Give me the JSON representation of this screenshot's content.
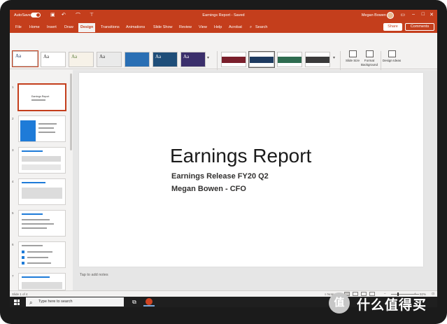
{
  "titlebar": {
    "autosave_label": "AutoSave",
    "autosave_state": "On",
    "doc_title": "Earnings Report - Saved",
    "user_name": "Megan Bowen"
  },
  "tabs": [
    "File",
    "Home",
    "Insert",
    "Draw",
    "Design",
    "Transitions",
    "Animations",
    "Slide Show",
    "Review",
    "View",
    "Help",
    "Acrobat"
  ],
  "active_tab": "Design",
  "search": {
    "label": "Search"
  },
  "share_label": "Share",
  "comments_label": "Comments",
  "ribbon": {
    "themes": [
      {
        "label": "Aa",
        "bg": "#ffffff",
        "fg": "#1f3864"
      },
      {
        "label": "Aa",
        "bg": "#ffffff",
        "fg": "#323130"
      },
      {
        "label": "Aa",
        "bg": "#f7f2e8",
        "fg": "#5a7c3a"
      },
      {
        "label": "Aa",
        "bg": "#eaeaea",
        "fg": "#323130"
      },
      {
        "label": "",
        "bg": "#2a6fb4",
        "fg": "#ffffff"
      },
      {
        "label": "Aa",
        "bg": "#1f4e79",
        "fg": "#ffffff"
      },
      {
        "label": "Aa",
        "bg": "#3b2f6b",
        "fg": "#ffffff"
      }
    ],
    "themes_group_label": "Themes",
    "variants": [
      {
        "bg": "#7a1f2b"
      },
      {
        "bg": "#1e3a5f"
      },
      {
        "bg": "#2e6b4f"
      },
      {
        "bg": "#3a3a3a"
      }
    ],
    "variants_group_label": "Variants",
    "slide_size_label": "Slide Size",
    "format_background_label": "Format Background",
    "customize_group_label": "Customize",
    "design_ideas_label": "Design Ideas",
    "designer_group_label": "Designer"
  },
  "thumbnails": [
    {
      "num": "1",
      "title": "Earnings Report"
    },
    {
      "num": "2",
      "title": ""
    },
    {
      "num": "3",
      "title": ""
    },
    {
      "num": "4",
      "title": ""
    },
    {
      "num": "5",
      "title": ""
    },
    {
      "num": "6",
      "title": ""
    },
    {
      "num": "7",
      "title": ""
    }
  ],
  "slide": {
    "title": "Earnings Report",
    "subtitle1": "Earnings Release FY20 Q2",
    "subtitle2": "Megan Bowen - CFO"
  },
  "notes_placeholder": "Tap to add notes",
  "status": {
    "slide_counter": "Slide 1 of 4",
    "notes_label": "Notes",
    "zoom": "92%"
  },
  "taskbar": {
    "search_placeholder": "Type here to search"
  },
  "watermark": {
    "logo": "值",
    "text": "什么值得买"
  }
}
